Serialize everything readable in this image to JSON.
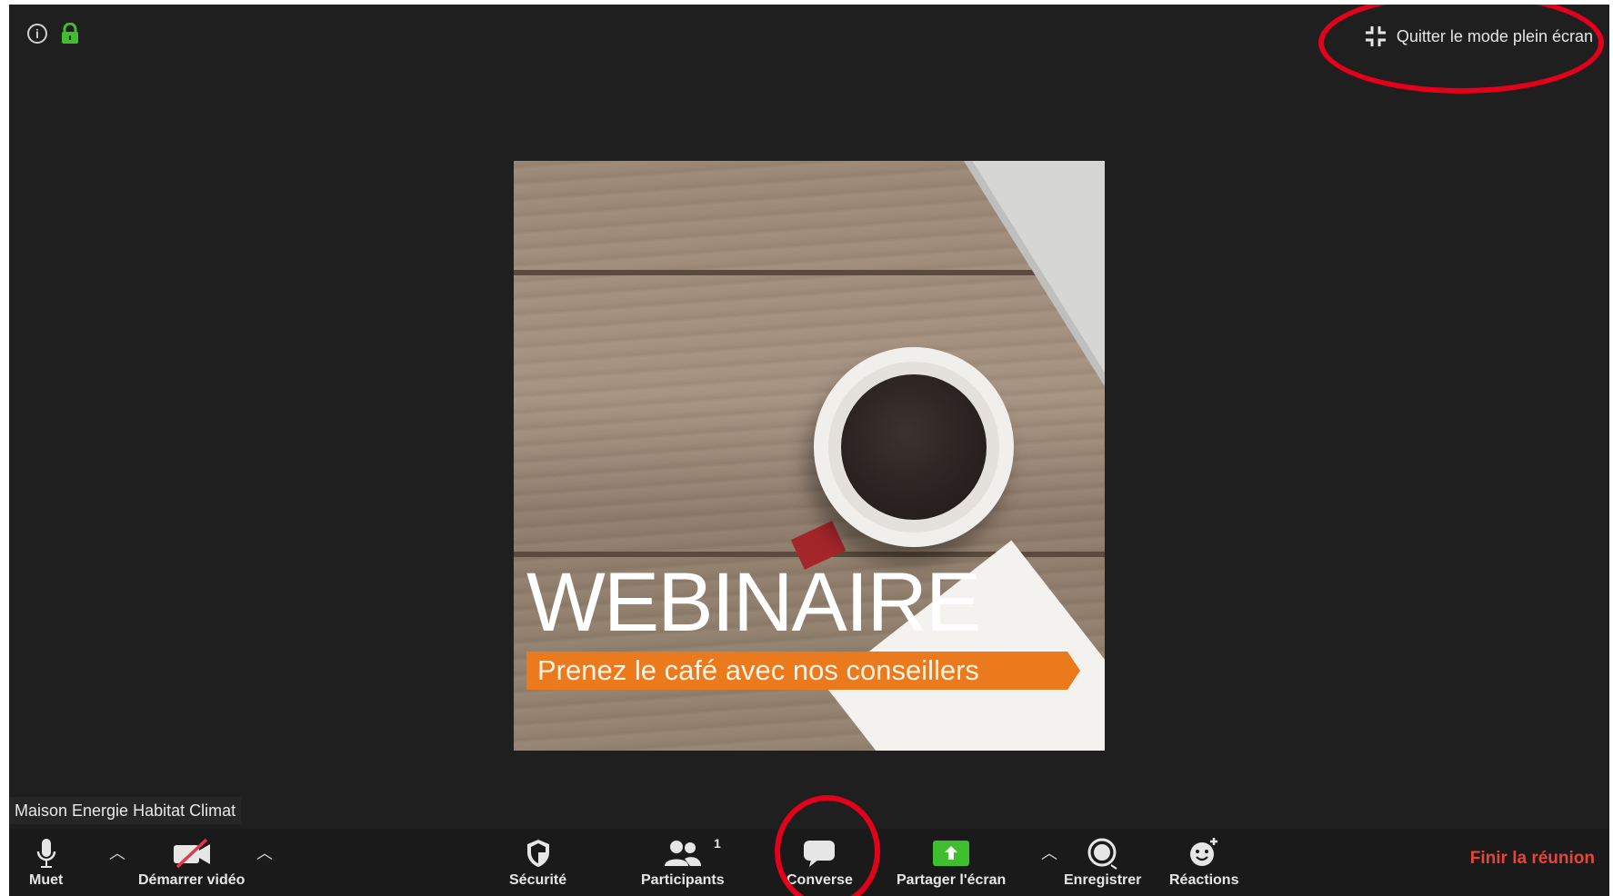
{
  "window": {
    "fullscreen_exit_label": "Quitter le mode plein écran"
  },
  "share": {
    "title": "WEBINAIRE",
    "subtitle": "Prenez le café avec nos conseillers"
  },
  "participant": {
    "name": "Maison Energie Habitat Climat"
  },
  "toolbar": {
    "mute_label": "Muet",
    "start_video_label": "Démarrer vidéo",
    "security_label": "Sécurité",
    "participants_label": "Participants",
    "participants_count": "1",
    "chat_label": "Converse",
    "share_screen_label": "Partager l'écran",
    "record_label": "Enregistrer",
    "reactions_label": "Réactions",
    "end_meeting_label": "Finir la réunion"
  },
  "colors": {
    "background": "#1f1f1f",
    "accent_green": "#3fbf2f",
    "end_red": "#e8443a",
    "annotation_red": "#e3001b",
    "banner_orange": "#ea7a1c"
  },
  "icons": [
    "info-icon",
    "lock-icon",
    "exit-fullscreen-icon",
    "microphone-icon",
    "video-off-icon",
    "shield-icon",
    "participants-icon",
    "chat-icon",
    "share-screen-icon",
    "record-icon",
    "reactions-icon"
  ]
}
